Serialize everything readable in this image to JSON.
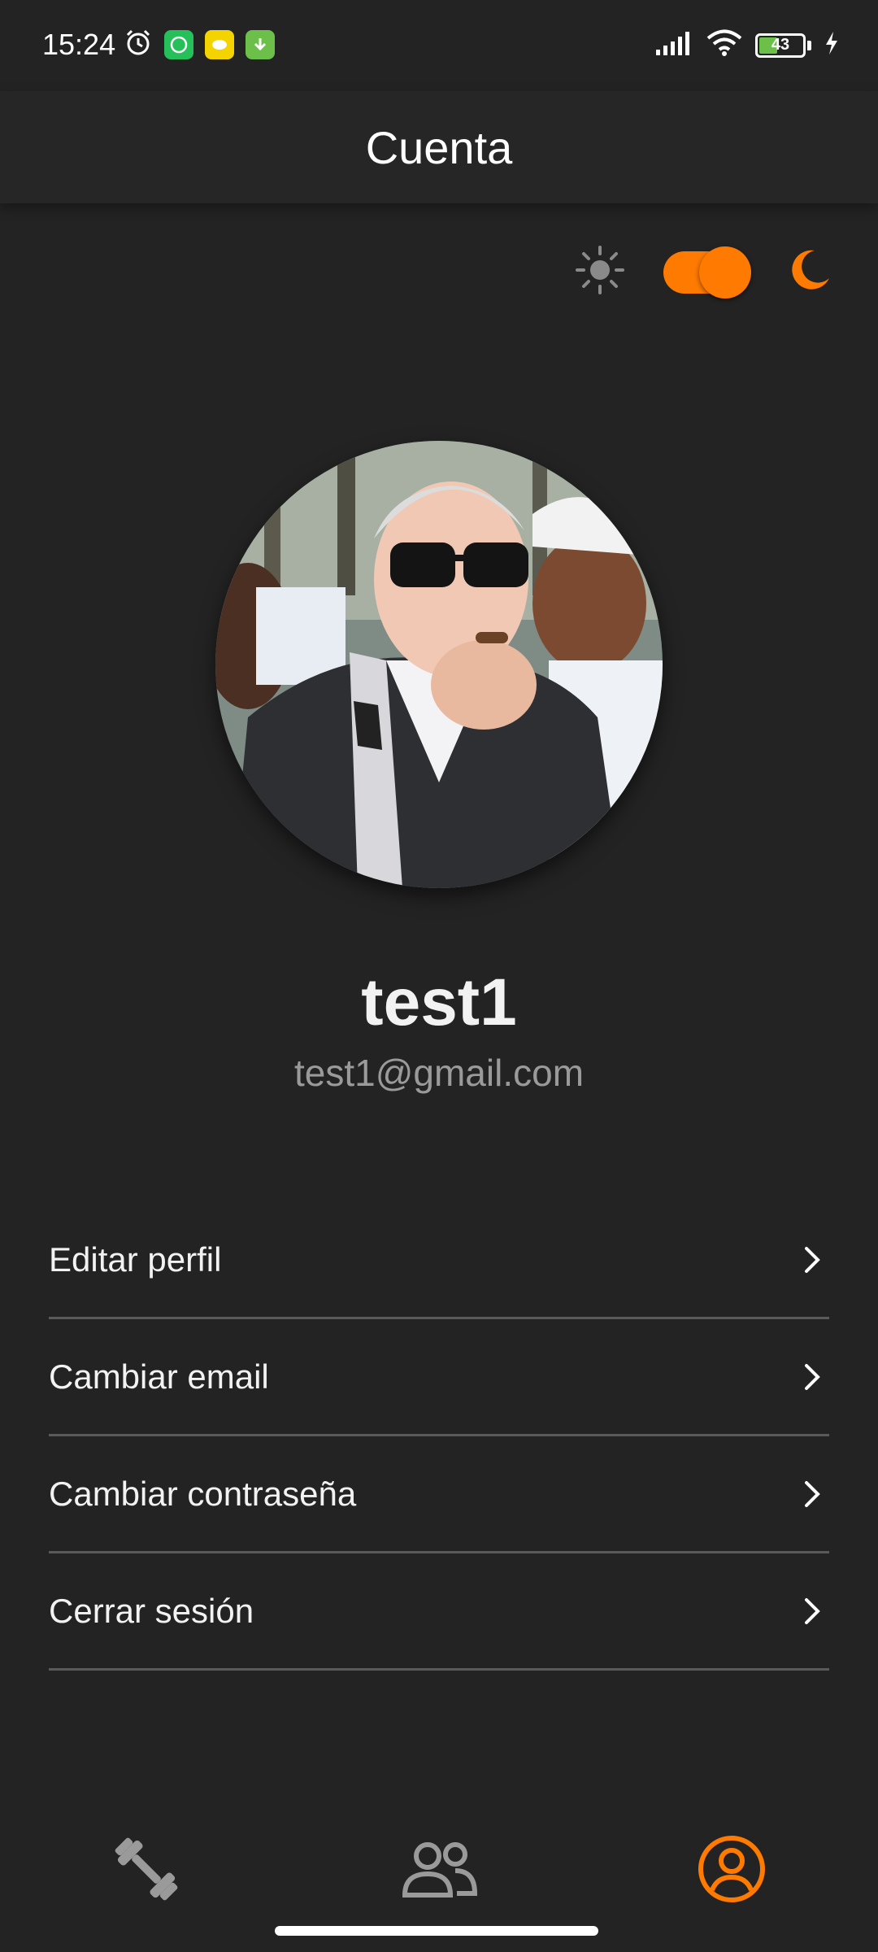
{
  "status_bar": {
    "time": "15:24",
    "battery_percent": "43",
    "battery_level": 0.43,
    "icons": [
      "alarm-icon",
      "whatsapp-icon",
      "messaging-app-icon",
      "download-icon",
      "signal-icon",
      "wifi-icon",
      "battery-icon",
      "charging-icon"
    ]
  },
  "header": {
    "title": "Cuenta"
  },
  "theme_toggle": {
    "light_icon": "sun-icon",
    "dark_icon": "moon-icon",
    "dark_mode_on": true,
    "accent_color": "#ff7a00"
  },
  "profile": {
    "name": "test1",
    "email": "test1@gmail.com"
  },
  "menu": {
    "items": [
      {
        "label": "Editar perfil"
      },
      {
        "label": "Cambiar email"
      },
      {
        "label": "Cambiar contraseña"
      },
      {
        "label": "Cerrar sesión"
      }
    ]
  },
  "bottom_nav": {
    "items": [
      {
        "icon": "dumbbell-icon",
        "active": false
      },
      {
        "icon": "people-icon",
        "active": false
      },
      {
        "icon": "account-circle-icon",
        "active": true
      }
    ]
  },
  "colors": {
    "background": "#232323",
    "accent": "#ff7a00",
    "divider": "#5a5a5a",
    "secondary_text": "#9a9a9a"
  }
}
